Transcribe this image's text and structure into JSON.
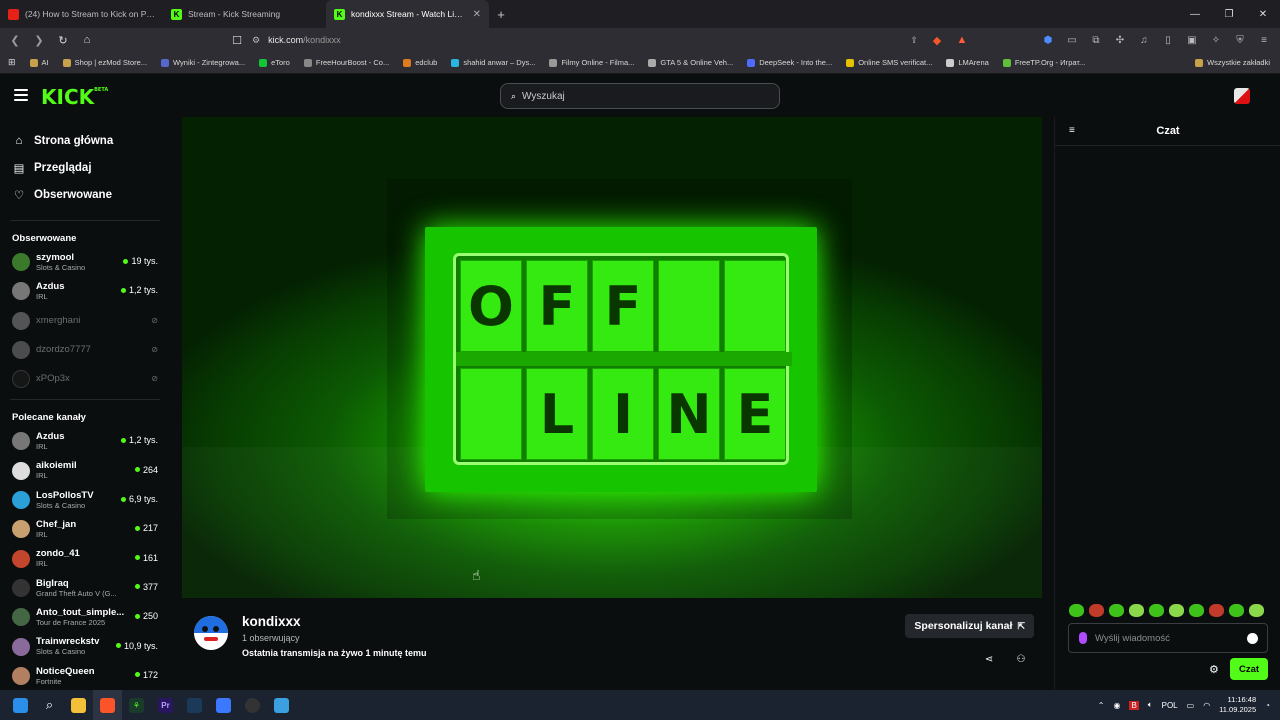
{
  "browser": {
    "tabs": [
      {
        "label": "(24) How to Stream to Kick on PC usi",
        "icon": "youtube-icon",
        "active": false
      },
      {
        "label": "Stream - Kick Streaming",
        "icon": "kick-icon",
        "active": false
      },
      {
        "label": "kondixxx Stream - Watch Live on",
        "icon": "kick-icon",
        "active": true
      }
    ],
    "new_tab": "+",
    "window_controls": [
      "—",
      "❐",
      "✕"
    ],
    "url_host": "kick.com",
    "url_path": "/kondixxx",
    "bookmarks": [
      "AI",
      "Shop | ezMod Store...",
      "Wyniki - Zintegrowa...",
      "eToro",
      "FreeHourBoost - Co...",
      "edclub",
      "shahid anwar – Dys...",
      "Filmy Online - Filma...",
      "GTA 5 & Online Veh...",
      "DeepSeek - Into the...",
      "Online SMS verificat...",
      "LMArena",
      "FreeTP.Org - Играт..."
    ],
    "all_bookmarks": "Wszystkie zakładki"
  },
  "kick": {
    "logo": "KICK",
    "logo_badge": "BETA",
    "search_placeholder": "Wyszukaj",
    "accent": "#53fc18"
  },
  "sidebar": {
    "nav": [
      {
        "label": "Strona główna",
        "icon": "home-icon"
      },
      {
        "label": "Przeglądaj",
        "icon": "browse-icon"
      },
      {
        "label": "Obserwowane",
        "icon": "heart-icon"
      }
    ],
    "followed_title": "Obserwowane",
    "followed": [
      {
        "name": "szymool",
        "category": "Slots & Casino",
        "viewers": "19 tys.",
        "live": true
      },
      {
        "name": "Azdus",
        "category": "IRL",
        "viewers": "1,2 tys.",
        "live": true
      },
      {
        "name": "xmerghani",
        "category": "",
        "viewers": "",
        "live": false
      },
      {
        "name": "dzordzo7777",
        "category": "",
        "viewers": "",
        "live": false
      },
      {
        "name": "xPOp3x",
        "category": "",
        "viewers": "",
        "live": false
      }
    ],
    "recommended_title": "Polecane kanały",
    "recommended": [
      {
        "name": "Azdus",
        "category": "IRL",
        "viewers": "1,2 tys."
      },
      {
        "name": "aikoiemil",
        "category": "IRL",
        "viewers": "264"
      },
      {
        "name": "LosPollosTV",
        "category": "Slots & Casino",
        "viewers": "6,9 tys."
      },
      {
        "name": "Chef_jan",
        "category": "IRL",
        "viewers": "217"
      },
      {
        "name": "zondo_41",
        "category": "IRL",
        "viewers": "161"
      },
      {
        "name": "BigIraq",
        "category": "Grand Theft Auto V (G...",
        "viewers": "377"
      },
      {
        "name": "Anto_tout_simple...",
        "category": "Tour de France 2025",
        "viewers": "250"
      },
      {
        "name": "Trainwreckstv",
        "category": "Slots & Casino",
        "viewers": "10,9 tys."
      },
      {
        "name": "NoticeQueen",
        "category": "Fortnite",
        "viewers": "172"
      }
    ]
  },
  "player": {
    "sign_top": [
      "O",
      "F",
      "F",
      "",
      ""
    ],
    "sign_bottom": [
      "",
      "L",
      "I",
      "N",
      "E"
    ]
  },
  "channel": {
    "name": "kondixxx",
    "followers": "1 obserwujący",
    "last_stream": "Ostatnia transmisja na żywo 1 minutę temu",
    "customize_label": "Spersonalizuj kanał"
  },
  "chat": {
    "title": "Czat",
    "placeholder": "Wyślij wiadomość",
    "send_label": "Czat"
  },
  "taskbar": {
    "lang": "POL",
    "time": "11:16:48",
    "date": "11.09.2025"
  }
}
